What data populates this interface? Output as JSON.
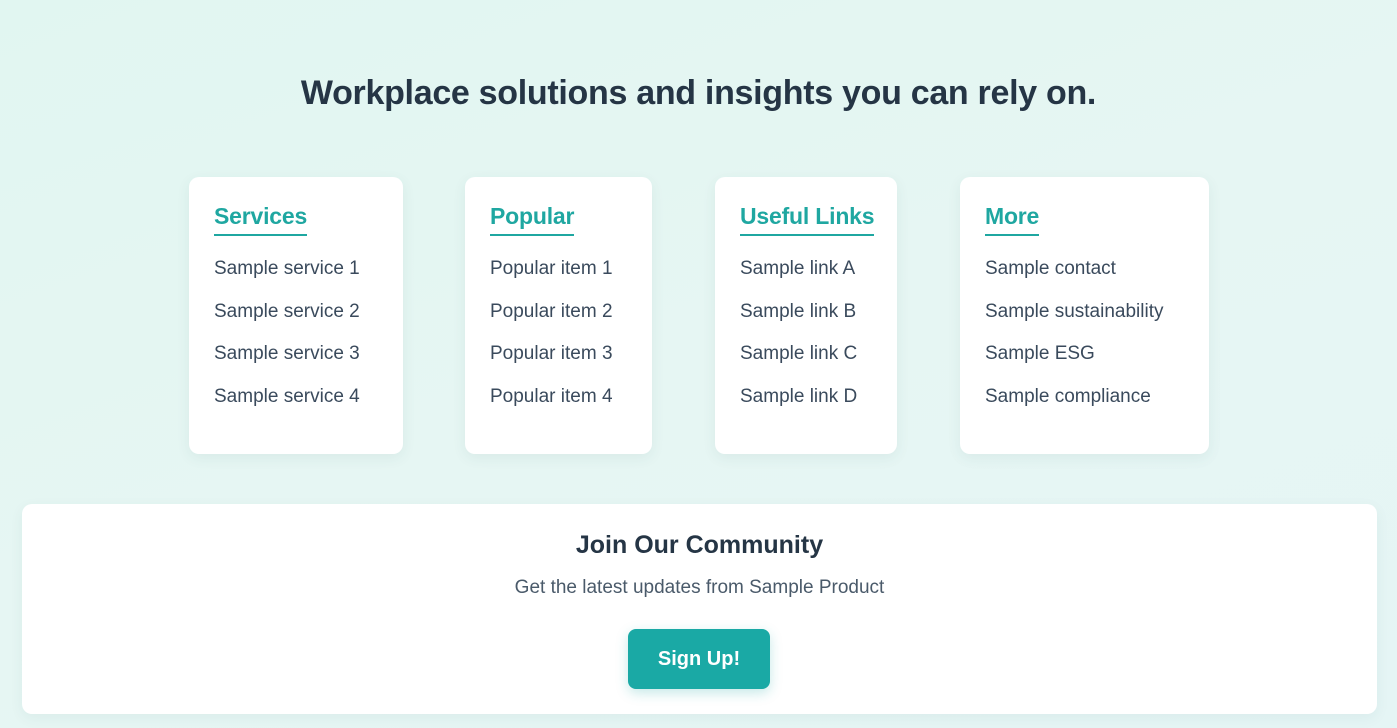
{
  "headline": "Workplace solutions and insights you can rely on.",
  "colors": {
    "accent": "#1fa7a1",
    "button": "#1aa9a5",
    "text_dark": "#253545",
    "background": "#e3f6f2"
  },
  "columns": [
    {
      "title": "Services",
      "items": [
        "Sample service 1",
        "Sample service 2",
        "Sample service 3",
        "Sample service 4"
      ]
    },
    {
      "title": "Popular",
      "items": [
        "Popular item 1",
        "Popular item 2",
        "Popular item 3",
        "Popular item 4"
      ]
    },
    {
      "title": "Useful Links",
      "items": [
        "Sample link A",
        "Sample link B",
        "Sample link C",
        "Sample link D"
      ]
    },
    {
      "title": "More",
      "items": [
        "Sample contact",
        "Sample sustainability",
        "Sample ESG",
        "Sample compliance"
      ]
    }
  ],
  "community": {
    "title": "Join Our Community",
    "subtitle": "Get the latest updates from Sample Product",
    "button_label": "Sign Up!"
  }
}
